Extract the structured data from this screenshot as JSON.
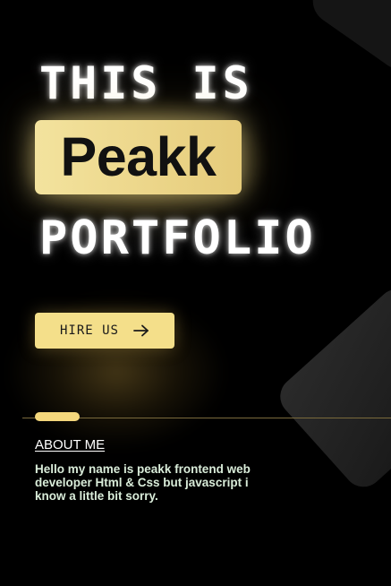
{
  "hero": {
    "line1": "THIS IS",
    "name": "Peakk",
    "line3": "PORTFOLIO"
  },
  "cta": {
    "hire_label": "HIRE US",
    "icon": "arrow-right-icon"
  },
  "about": {
    "heading": "ABOUT ME",
    "text": "Hello my name is peakk frontend web developer Html & Css but javascript i know a little bit sorry."
  },
  "colors": {
    "background": "#000000",
    "accent": "#f4df8a",
    "name_box": "#efdb92",
    "divider": "#7a6a3c",
    "about_text": "#d9ecd9"
  }
}
